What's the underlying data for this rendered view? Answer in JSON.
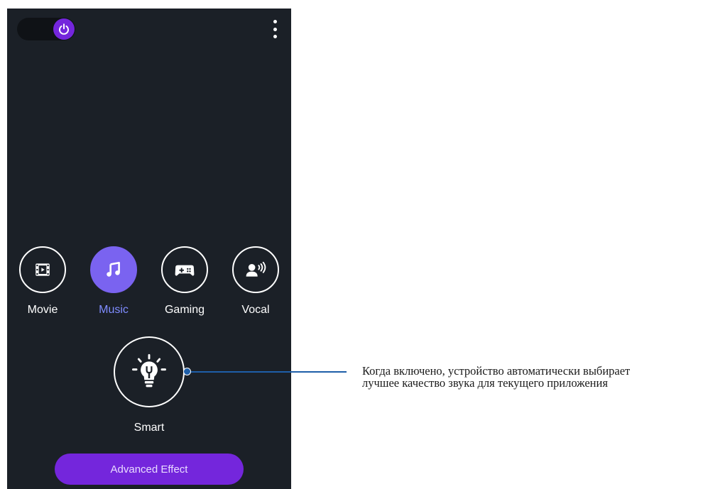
{
  "app": {
    "power_toggle": {
      "state": "on",
      "accent": "#7426dc",
      "icon": "power-icon"
    },
    "menu_icon": "more-vert-icon"
  },
  "modes": [
    {
      "label": "Movie",
      "icon": "movie-icon",
      "active": false
    },
    {
      "label": "Music",
      "icon": "music-note-icon",
      "active": true
    },
    {
      "label": "Gaming",
      "icon": "gamepad-icon",
      "active": false
    },
    {
      "label": "Vocal",
      "icon": "vocal-icon",
      "active": false
    }
  ],
  "smart": {
    "label": "Smart",
    "icon": "lightbulb-icon"
  },
  "advanced_button": {
    "label": "Advanced Effect"
  },
  "callout": {
    "line1": "Когда включено, устройство автоматически выбирает",
    "line2": "лучшее качество звука для текущего приложения"
  },
  "colors": {
    "background": "#1b2027",
    "accent_purple": "#7426dc",
    "active_mode": "#7a63f0",
    "callout_line": "#1e5ea8"
  }
}
